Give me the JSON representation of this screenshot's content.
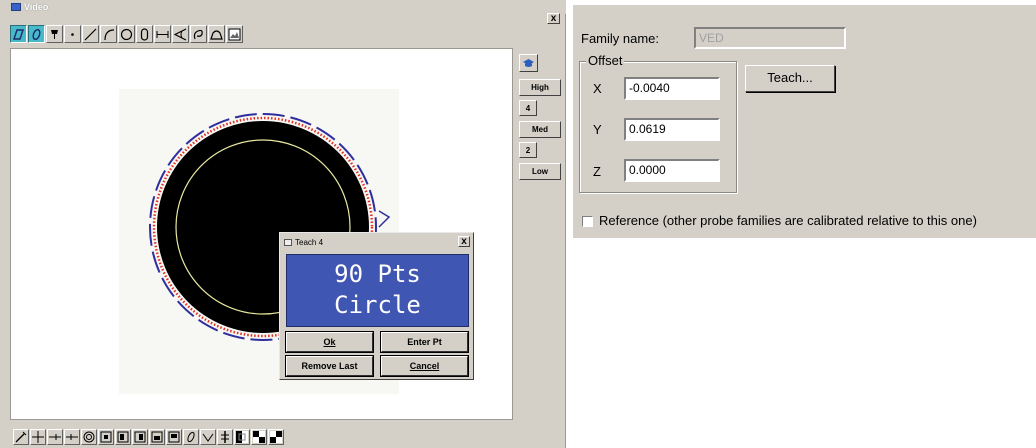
{
  "video_window": {
    "title": "Video",
    "close_label": "x",
    "toolbar_top_icons": [
      "rectangle-select-icon",
      "ellipse-select-icon",
      "probe-icon",
      "point-icon",
      "line-icon",
      "arc-icon",
      "circle-icon",
      "slot-icon",
      "distance-icon",
      "angle-icon",
      "loop-icon",
      "arc-segment-icon",
      "picture-icon"
    ],
    "toolbar_bottom_icons": [
      "wand-icon",
      "crosshair-icon",
      "edge-left-icon",
      "edge-right-icon",
      "target-icon",
      "box-edge-1-icon",
      "box-edge-2-icon",
      "box-edge-3-icon",
      "box-edge-4-icon",
      "box-edge-5-icon",
      "ellipse-tool-icon",
      "chevron-tool-icon",
      "split-icon",
      "checker-1-icon",
      "checker-2-icon",
      "checker-3-icon"
    ],
    "side_panel": {
      "buttons": [
        {
          "label": ""
        },
        {
          "label": "High"
        },
        {
          "label": "4"
        },
        {
          "label": "Med"
        },
        {
          "label": "2"
        },
        {
          "label": "Low"
        }
      ]
    }
  },
  "teach_dialog": {
    "title": "Teach 4",
    "close_label": "x",
    "display_line1": "90 Pts",
    "display_line2": "Circle",
    "ok_label": "Ok",
    "enter_pt_label": "Enter Pt",
    "remove_last_label": "Remove Last",
    "cancel_label": "Cancel"
  },
  "family_dialog": {
    "family_name_label": "Family name:",
    "family_name_value": "VED",
    "offset_group_label": "Offset",
    "x_label": "X",
    "x_value": "-0.0040",
    "y_label": "Y",
    "y_value": "0.0619",
    "z_label": "Z",
    "z_value": "0.0000",
    "teach_button_label": "Teach...",
    "reference_label": "Reference (other probe families are calibrated relative to this one)",
    "reference_checked": false
  },
  "colors": {
    "display_blue": "#3f56b3",
    "tool_selected": "#47b9c9",
    "dash_circle": "#2e2e9e",
    "edge_points": "#e03020",
    "inner_circle": "#e8e8a0"
  }
}
